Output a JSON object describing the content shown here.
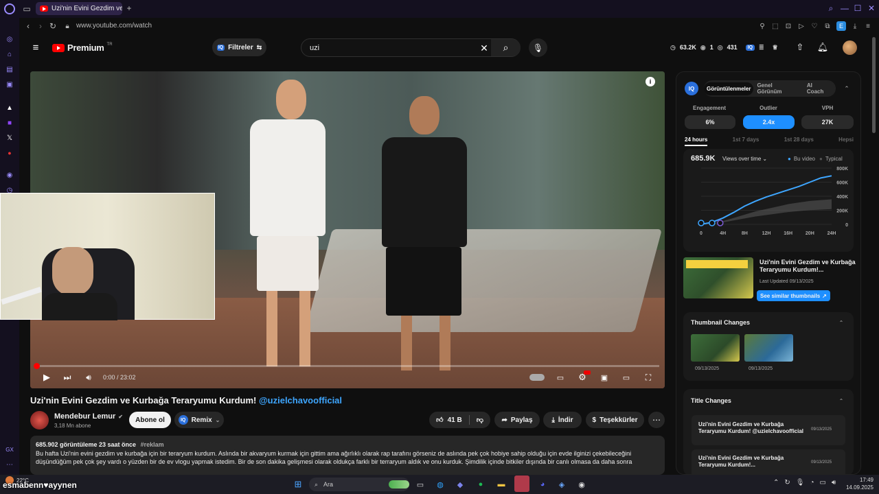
{
  "browser": {
    "tab_title": "Uzi'nin Evini Gezdim ve K...",
    "url": "www.youtube.com/watch"
  },
  "header": {
    "logo_text": "Premium",
    "logo_sup": "TR",
    "filter_label": "Filtreler",
    "search_value": "uzi",
    "stat_views": "63.2K",
    "stat_one": "1",
    "stat_count": "431"
  },
  "video": {
    "time": "0:00 / 23:02",
    "progress_fraction": 0.0
  },
  "watch": {
    "title": "Uzi'nin Evini Gezdim ve Kurbağa Teraryumu Kurdum!",
    "mention": "@uzielchavoofficial",
    "channel_name": "Mendebur Lemur",
    "subscribers": "3,18 Mn abone",
    "subscribe_label": "Abone ol",
    "remix_label": "Remix",
    "likes": "41 B",
    "share_label": "Paylaş",
    "download_label": "İndir",
    "thanks_label": "Teşekkürler",
    "desc_meta": "685.902 görüntüleme  23 saat önce",
    "desc_tag": "#reklam",
    "desc_text": "Bu hafta Uzi'nin evini gezdim ve kurbağa için bir teraryum kurdum.  Aslında bir akvaryum kurmak için gittim ama ağırlıklı olarak rap tarafını görseniz de aslında pek çok hobiye sahip olduğu için evde ilginizi çekebileceğini düşündüğüm pek çok şey vardı o yüzden bir de ev vlogu yapmak istedim. Bir de son dakika gelişmesi olarak oldukça farklı bir terraryum aldık ve onu kurduk. Şimdilik içinde bitkiler dışında bir canlı olmasa da daha sonra"
  },
  "sidepanel": {
    "tabs": [
      "Görüntülenmeler",
      "Genel Görünüm",
      "AI Coach"
    ],
    "metric_labels": [
      "Engagement",
      "Outlier",
      "VPH"
    ],
    "metric_values": [
      "6%",
      "2.4x",
      "27K"
    ],
    "range_tabs": [
      "24 hours",
      "1st 7 days",
      "1st 28 days",
      "Hepsi"
    ],
    "views_total": "685.9K",
    "views_mode": "Views over time",
    "legend_video": "Bu video",
    "legend_typical": "Typical",
    "thumb_title": "Uzi'nin Evini Gezdim ve Kurbağa Teraryumu Kurdum!...",
    "thumb_updated": "Last Updated 09/13/2025",
    "similar_btn": "See similar thumbnails",
    "thumb_changes_title": "Thumbnail Changes",
    "thumb_dates": [
      "09/13/2025",
      "09/13/2025"
    ],
    "title_changes_title": "Title Changes",
    "title_changes": [
      {
        "text": "Uzi'nin Evini Gezdim ve Kurbağa Teraryumu Kurdum! @uzielchavoofficial",
        "date": "09/13/2025"
      },
      {
        "text": "Uzi'nin Evini Gezdim ve Kurbağa Teraryumu Kurdum!...",
        "date": "09/13/2025"
      }
    ]
  },
  "chart_data": {
    "type": "area",
    "x": [
      0,
      2,
      4,
      6,
      8,
      10,
      12,
      14,
      16,
      18,
      20,
      22,
      24
    ],
    "xticks": [
      "0",
      "4H",
      "8H",
      "12H",
      "16H",
      "20H",
      "24H"
    ],
    "yticks": [
      "800K",
      "600K",
      "400K",
      "200K",
      "0"
    ],
    "ylim": [
      0,
      800000
    ],
    "series": [
      {
        "name": "Bu video",
        "values": [
          0,
          30000,
          90000,
          170000,
          260000,
          330000,
          390000,
          440000,
          490000,
          540000,
          600000,
          660000,
          690000
        ],
        "color": "#3ea6ff"
      },
      {
        "name": "Typical",
        "values": [
          0,
          10000,
          40000,
          80000,
          120000,
          160000,
          190000,
          220000,
          250000,
          270000,
          290000,
          300000,
          310000
        ],
        "color": "#555555"
      }
    ]
  },
  "taskbar": {
    "weather": "22°C",
    "search_label": "Ara",
    "time": "17:49",
    "date": "14.09.2025"
  },
  "overlay": {
    "streamer_text": "esmabenn♥ayynen"
  }
}
